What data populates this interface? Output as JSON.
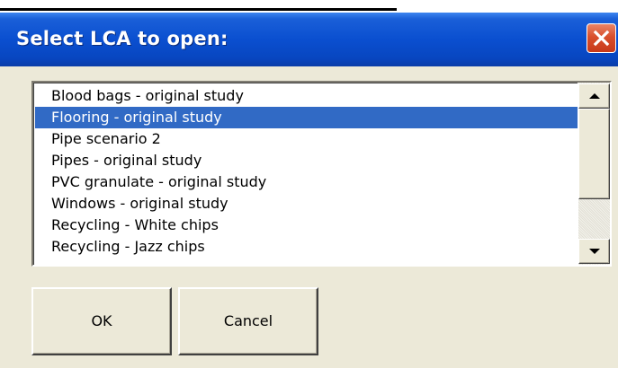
{
  "dialog": {
    "title": "Select LCA to open:",
    "close_icon": "close-x-icon"
  },
  "list": {
    "items": [
      "Blood bags - original study",
      "Flooring - original study",
      "Pipe scenario 2",
      "Pipes  - original study",
      "PVC granulate - original study",
      "Windows - original study",
      "Recycling - White chips",
      "Recycling - Jazz chips"
    ],
    "selected_index": 1,
    "selection_color": "#316ac5"
  },
  "scrollbar": {
    "up_icon": "arrow-up-icon",
    "down_icon": "arrow-down-icon"
  },
  "buttons": {
    "ok_label": "OK",
    "cancel_label": "Cancel"
  },
  "colors": {
    "titlebar": "#0a4fd0",
    "dialog_bg": "#ece9d8",
    "close_button": "#d94f2c"
  }
}
